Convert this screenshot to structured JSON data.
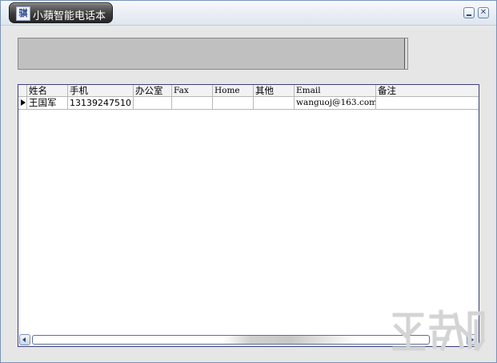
{
  "window": {
    "title": "小蘋智能电话本",
    "icon_char": "骐",
    "icon": "app-icon",
    "controls": {
      "minimize_icon": "minimize-icon",
      "close_icon": "close-icon",
      "close_glyph": "✕"
    }
  },
  "grid": {
    "columns": [
      "姓名",
      "手机",
      "办公室",
      "Fax",
      "Home",
      "其他",
      "Email",
      "备注"
    ],
    "rows": [
      {
        "name": "王国军",
        "mobile": "13139247510",
        "office": "",
        "fax": "",
        "home": "",
        "other": "",
        "email": "wanguoj@163.com",
        "note": ""
      }
    ],
    "current_row_marker": "triangle-right-icon"
  },
  "scrollbar": {
    "left_icon": "scroll-left-icon",
    "right_icon": "scroll-right-icon"
  },
  "colors": {
    "title_tab": "#2e2e2e",
    "grid_border": "#3b3f77",
    "display_bar": "#c0c0c0"
  }
}
